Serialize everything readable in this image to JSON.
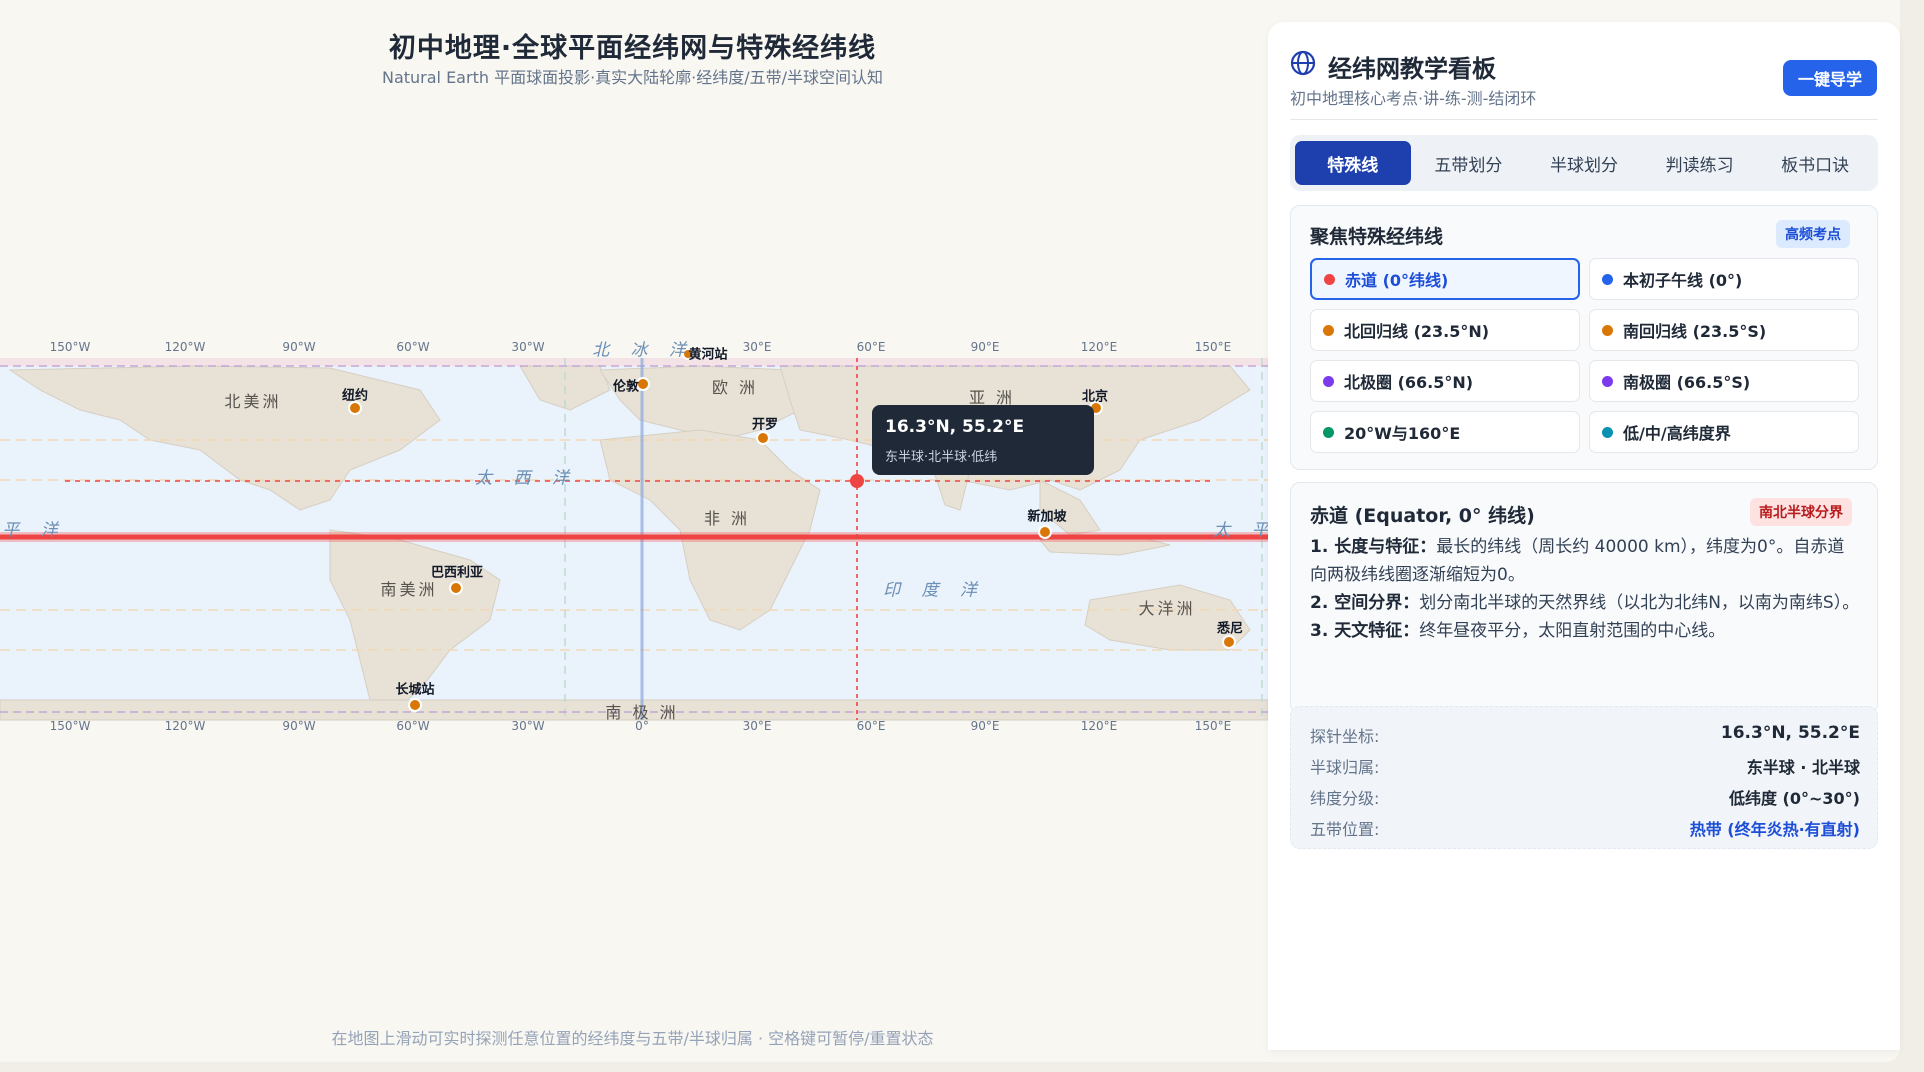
{
  "header": {
    "title": "初中地理·全球平面经纬网与特殊经纬线",
    "subtitle": "Natural Earth 平面球面投影·真实大陆轮廓·经纬度/五带/半球空间认知",
    "footer": "在地图上滑动可实时探测任意位置的经纬度与五带/半球归属 · 空格键可暂停/重置状态"
  },
  "map": {
    "top_ticks": [
      "150°W",
      "120°W",
      "90°W",
      "60°W",
      "30°W",
      "60°E",
      "90°E",
      "120°E",
      "150°E",
      "30°E"
    ],
    "bottom_ticks": [
      "150°W",
      "120°W",
      "90°W",
      "60°W",
      "30°W",
      "0°",
      "30°E",
      "60°E",
      "90°E",
      "120°E",
      "150°E"
    ],
    "continents": [
      "北美洲",
      "欧 洲",
      "亚 洲",
      "非 洲",
      "南美洲",
      "大洋洲",
      "南 极 洲"
    ],
    "oceans": [
      "北 冰 洋",
      "太 西 洋",
      "印 度 洋",
      "平 洋",
      "太 平"
    ],
    "cities": [
      "黄河站",
      "纽约",
      "伦敦",
      "开罗",
      "北京",
      "新加坡",
      "巴西利亚",
      "悉尼",
      "长城站"
    ],
    "tooltip": {
      "coord": "16.3°N, 55.2°E",
      "info": "东半球·北半球·低纬"
    },
    "colors": {
      "equator": "#ef4444",
      "tropic": "#f59e0b",
      "polar": "#8b5cf6",
      "land": "#e7e1d6",
      "sea": "#eaf2fb"
    }
  },
  "panel": {
    "title": "经纬网教学看板",
    "subtitle": "初中地理核心考点·讲-练-测-结闭环",
    "guide_button": "一键导学",
    "tabs": [
      "特殊线",
      "五带划分",
      "半球划分",
      "判读练习",
      "板书口诀"
    ],
    "focus": {
      "title": "聚焦特殊经纬线",
      "badge": "高频考点",
      "lines": [
        {
          "label": "赤道 (0°纬线)",
          "color": "#ef4444"
        },
        {
          "label": "本初子午线 (0°)",
          "color": "#2563eb"
        },
        {
          "label": "北回归线 (23.5°N)",
          "color": "#d97706"
        },
        {
          "label": "南回归线 (23.5°S)",
          "color": "#d97706"
        },
        {
          "label": "北极圈 (66.5°N)",
          "color": "#7c3aed"
        },
        {
          "label": "南极圈 (66.5°S)",
          "color": "#7c3aed"
        },
        {
          "label": "20°W与160°E",
          "color": "#059669"
        },
        {
          "label": "低/中/高纬度界",
          "color": "#0891b2"
        }
      ]
    },
    "detail": {
      "title": "赤道 (Equator, 0° 纬线)",
      "badge": "南北半球分界",
      "p1_head": "1. 长度与特征：",
      "p1_body": "最长的纬线（周长约 40000 km），纬度为0°。自赤道向两极纬线圈逐渐缩短为0。",
      "p2_head": "2. 空间分界：",
      "p2_body": "划分南北半球的天然界线（以北为北纬N，以南为南纬S）。",
      "p3_head": "3. 天文特征：",
      "p3_body": "终年昼夜平分，太阳直射范围的中心线。"
    },
    "probe": {
      "coord_key": "探针坐标:",
      "coord_val": "16.3°N, 55.2°E",
      "hemi_key": "半球归属:",
      "hemi_val": "东半球 · 北半球",
      "lat_key": "纬度分级:",
      "lat_val": "低纬度 (0°~30°)",
      "zone_key": "五带位置:",
      "zone_val": "热带 (终年炎热·有直射)"
    }
  }
}
